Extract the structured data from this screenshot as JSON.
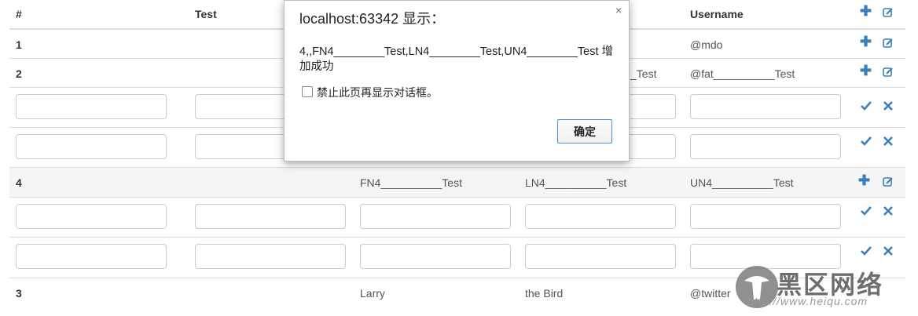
{
  "table": {
    "headers": [
      "#",
      "Test",
      "Username"
    ],
    "rows": [
      {
        "num": "1",
        "username": "@mdo"
      },
      {
        "num": "2",
        "last": "_Test",
        "username": "@fat__________Test"
      },
      {
        "num": "4",
        "first": "FN4__________Test",
        "last": "LN4__________Test",
        "username": "UN4__________Test"
      },
      {
        "num": "3",
        "first": "Larry",
        "last": "the Bird",
        "username": "@twitter"
      }
    ]
  },
  "dialog": {
    "title": "localhost:63342 显示：",
    "close_glyph": "×",
    "message": "4,,FN4________Test,LN4________Test,UN4________Test 增加成功",
    "checkbox_label": "禁止此页再显示对话框。",
    "ok_label": "确定"
  },
  "watermark": {
    "text": "黑区网络",
    "url": "http://www.heiqu.com"
  },
  "colors": {
    "action_icon": "#3a7fb8",
    "row_stripe": "#f5f5f5",
    "border": "#dddddd"
  }
}
